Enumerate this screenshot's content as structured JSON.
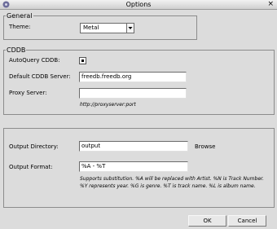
{
  "window": {
    "title": "Options",
    "close_glyph": "×",
    "icon": "app-logo-icon"
  },
  "general": {
    "title": "General",
    "theme_label": "Theme:",
    "theme_value": "Metal"
  },
  "cddb": {
    "title": "CDDB",
    "autoquery_label": "AutoQuery CDDB:",
    "autoquery_checked": true,
    "server_label": "Default CDDB Server:",
    "server_value": "freedb.freedb.org",
    "proxy_label": "Proxy Server:",
    "proxy_value": "",
    "proxy_hint": "http://proxyserver:port"
  },
  "output": {
    "dir_label": "Output Directory:",
    "dir_value": "output",
    "browse_label": "Browse",
    "format_label": "Output Format:",
    "format_value": "%A - %T",
    "help_text": "Supports substitution. %A will be replaced with Artist. %N is Track Number. %Y represents year. %G is genre. %T is track name. %L is album name."
  },
  "buttons": {
    "ok": "OK",
    "cancel": "Cancel"
  }
}
